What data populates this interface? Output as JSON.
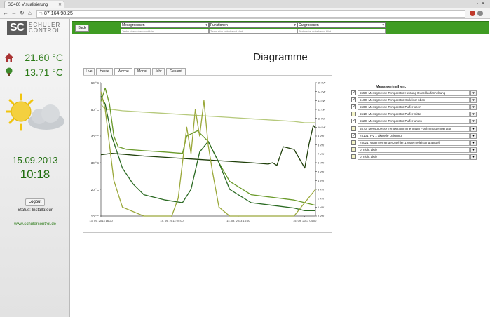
{
  "browser": {
    "tab_title": "SC460 Visualisierung",
    "url": "87.164.98.25"
  },
  "sidebar": {
    "logo_short": "SC",
    "logo_line1": "SCHULER",
    "logo_line2": "CONTROL",
    "indoor_temp": "21.60 °C",
    "outdoor_temp": "13.71 °C",
    "date": "15.09.2013",
    "time": "10:18",
    "logout_label": "Logout",
    "status": "Status: Installateur",
    "website": "www.schulercontrol.de"
  },
  "toolbar": {
    "back_label": "Back",
    "select1": "Messgroessen",
    "select2": "Funktionen",
    "select3": "Outgroessen",
    "filter_placeholder": "Textsuche unbekannt Hint"
  },
  "page_title": "Diagramme",
  "chart_tabs": [
    "Live",
    "Heute",
    "Woche",
    "Monat",
    "Jahr",
    "Gesamt"
  ],
  "legend": {
    "title": "Messwertreihen:",
    "items": [
      {
        "label": "5550. Messgroesse Temperatur Heizung Ruecklaufanhebung",
        "checked": true,
        "color": "#1f3f0a"
      },
      {
        "label": "5100. Messgroesse Temperatur Kollektor oben",
        "checked": true,
        "color": "#6a9a2a"
      },
      {
        "label": "5500. Messgroesse Temperatur Puffer oben",
        "checked": true,
        "color": "#b6c97c"
      },
      {
        "label": "5510. Messgroesse Temperatur Puffer mitte",
        "checked": false,
        "color": "#aaaaaa"
      },
      {
        "label": "5520. Messgroesse Temperatur Puffer unten",
        "checked": true,
        "color": "#2a6a22"
      },
      {
        "label": "5570. Messgroesse Temperatur Innenraum Fuehrungstemperatur",
        "checked": false,
        "color": "#aaaaaa"
      },
      {
        "label": "78101. PV 1 aktuelle Leistung",
        "checked": true,
        "color": "#9aa83a"
      },
      {
        "label": "78021. Waermemengenzaehler 1 Waermeleistung aktuell",
        "checked": false,
        "color": "#aaaaaa"
      },
      {
        "label": "0. nicht aktiv",
        "checked": false,
        "color": "#aaaaaa"
      },
      {
        "label": "0. nicht aktiv",
        "checked": false,
        "color": "#aaaaaa"
      }
    ]
  },
  "chart_data": {
    "type": "line",
    "x_ticks": [
      "13. 09. 2013 16:20",
      "14. 09. 2013 04:00",
      "14. 09. 2013 16:00",
      "15. 09. 2013 04:00"
    ],
    "y_left_ticks": [
      "10 °C",
      "20 °C",
      "30 °C",
      "40 °C",
      "50 °C",
      "60 °C"
    ],
    "y_right_ticks": [
      "0 kW",
      "1 kW",
      "2 kW",
      "3 kW",
      "4 kW",
      "5 kW",
      "6 kW",
      "7 kW",
      "8 kW",
      "9 kW",
      "10 kW",
      "11 kW",
      "12 kW",
      "13 kW",
      "14 kW",
      "15 kW"
    ],
    "ylim": [
      10,
      60
    ],
    "y2lim": [
      0,
      15
    ],
    "grid": false,
    "series": [
      {
        "name": "5500. Messgroesse Temperatur Puffer oben",
        "axis": "left",
        "color": "#b6c97c",
        "x": [
          0,
          0.02,
          0.05,
          0.1,
          0.2,
          0.3,
          0.4,
          0.5,
          0.6,
          0.7,
          0.8,
          0.9,
          0.95,
          1.0
        ],
        "y": [
          52,
          50,
          50,
          49.5,
          49,
          48.5,
          48,
          47.5,
          47,
          46.5,
          46,
          45.5,
          45,
          45
        ]
      },
      {
        "name": "5550. Messgroesse Temperatur Heizung Ruecklaufanhebung",
        "axis": "left",
        "color": "#1f3f0a",
        "x": [
          0,
          0.05,
          0.1,
          0.2,
          0.3,
          0.4,
          0.5,
          0.6,
          0.7,
          0.78,
          0.8,
          0.82,
          0.85,
          0.9,
          0.95,
          0.97,
          0.99,
          1.0
        ],
        "y": [
          33,
          33.5,
          33.2,
          32.5,
          32,
          31.5,
          31,
          30.5,
          30,
          29.5,
          30,
          29,
          36,
          35,
          28,
          37,
          44,
          43
        ]
      },
      {
        "name": "5100. Messgroesse Temperatur Kollektor oben",
        "axis": "left",
        "color": "#6a9a2a",
        "x": [
          0,
          0.02,
          0.04,
          0.06,
          0.08,
          0.12,
          0.2,
          0.3,
          0.38,
          0.4,
          0.45,
          0.5,
          0.55,
          0.6,
          0.7,
          0.8,
          0.9,
          0.95,
          1.0
        ],
        "y": [
          53,
          58,
          52,
          40,
          36,
          35,
          34.5,
          34,
          33.5,
          40,
          42,
          38,
          30,
          23,
          18,
          17,
          16,
          15,
          14
        ]
      },
      {
        "name": "5520. Messgroesse Temperatur Puffer unten",
        "axis": "left",
        "color": "#2a6a22",
        "x": [
          0,
          0.02,
          0.05,
          0.1,
          0.15,
          0.2,
          0.3,
          0.38,
          0.42,
          0.46,
          0.5,
          0.55,
          0.6,
          0.7,
          0.8,
          0.9,
          0.95,
          1.0
        ],
        "y": [
          55,
          52,
          40,
          28,
          22,
          18,
          16,
          15,
          20,
          34,
          38,
          30,
          20,
          15,
          14,
          13,
          12,
          12
        ]
      },
      {
        "name": "78101. PV 1 aktuelle Leistung",
        "axis": "right",
        "color": "#9aa83a",
        "x": [
          0,
          0.02,
          0.04,
          0.06,
          0.1,
          0.2,
          0.33,
          0.36,
          0.38,
          0.4,
          0.42,
          0.44,
          0.46,
          0.48,
          0.5,
          0.52,
          0.55,
          0.6,
          0.7,
          0.8,
          0.9,
          1.0
        ],
        "y": [
          14,
          12,
          8,
          4,
          1,
          0,
          0,
          2,
          6,
          10,
          7,
          12,
          9,
          13,
          8,
          5,
          1,
          0,
          0,
          0,
          0,
          3
        ]
      }
    ]
  }
}
